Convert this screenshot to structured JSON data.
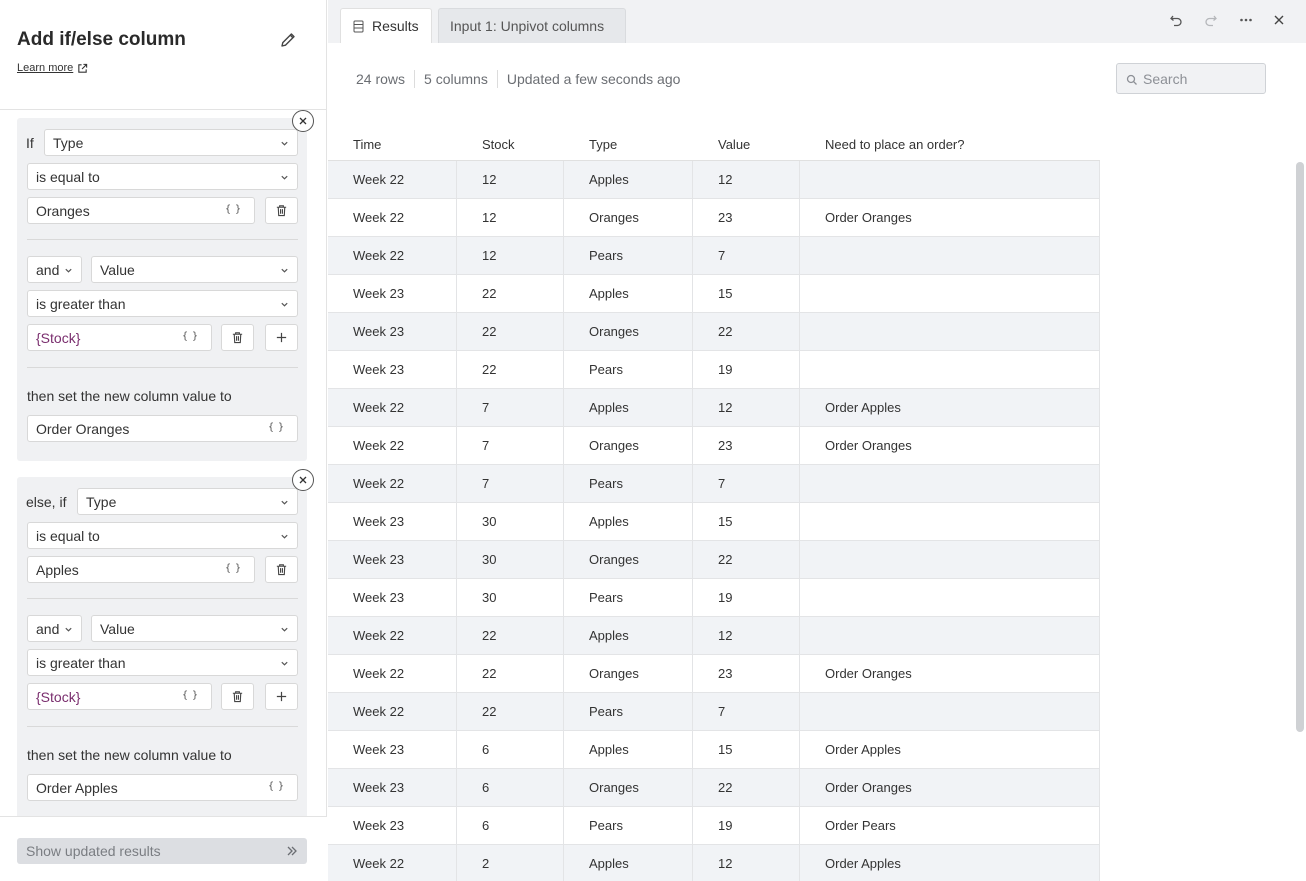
{
  "panel": {
    "title": "Add if/else column",
    "learn_more": "Learn more"
  },
  "condition_blocks": [
    {
      "lead_label": "If",
      "column": "Type",
      "operator": "is equal to",
      "value": "Oranges",
      "and_label": "and",
      "and_column": "Value",
      "and_operator": "is greater than",
      "and_value": "{Stock}",
      "then_label": "then set the new column value to",
      "then_value": "Order Oranges"
    },
    {
      "lead_label": "else, if",
      "column": "Type",
      "operator": "is equal to",
      "value": "Apples",
      "and_label": "and",
      "and_column": "Value",
      "and_operator": "is greater than",
      "and_value": "{Stock}",
      "then_label": "then set the new column value to",
      "then_value": "Order Apples"
    }
  ],
  "footer": {
    "show_results": "Show updated results"
  },
  "tabs": [
    {
      "label": "Results",
      "active": true
    },
    {
      "label": "Input 1: Unpivot columns",
      "active": false
    }
  ],
  "toolbar_icons": [
    "undo-icon",
    "redo-icon",
    "more-icon",
    "close-icon"
  ],
  "meta": {
    "rows": "24 rows",
    "columns": "5 columns",
    "updated": "Updated a few seconds ago"
  },
  "search": {
    "placeholder": "Search"
  },
  "table": {
    "headers": [
      "Time",
      "Stock",
      "Type",
      "Value",
      "Need to place an order?"
    ],
    "rows": [
      [
        "Week 22",
        "12",
        "Apples",
        "12",
        ""
      ],
      [
        "Week 22",
        "12",
        "Oranges",
        "23",
        "Order Oranges"
      ],
      [
        "Week 22",
        "12",
        "Pears",
        "7",
        ""
      ],
      [
        "Week 23",
        "22",
        "Apples",
        "15",
        ""
      ],
      [
        "Week 23",
        "22",
        "Oranges",
        "22",
        ""
      ],
      [
        "Week 23",
        "22",
        "Pears",
        "19",
        ""
      ],
      [
        "Week 22",
        "7",
        "Apples",
        "12",
        "Order Apples"
      ],
      [
        "Week 22",
        "7",
        "Oranges",
        "23",
        "Order Oranges"
      ],
      [
        "Week 22",
        "7",
        "Pears",
        "7",
        ""
      ],
      [
        "Week 23",
        "30",
        "Apples",
        "15",
        ""
      ],
      [
        "Week 23",
        "30",
        "Oranges",
        "22",
        ""
      ],
      [
        "Week 23",
        "30",
        "Pears",
        "19",
        ""
      ],
      [
        "Week 22",
        "22",
        "Apples",
        "12",
        ""
      ],
      [
        "Week 22",
        "22",
        "Oranges",
        "23",
        "Order Oranges"
      ],
      [
        "Week 22",
        "22",
        "Pears",
        "7",
        ""
      ],
      [
        "Week 23",
        "6",
        "Apples",
        "15",
        "Order Apples"
      ],
      [
        "Week 23",
        "6",
        "Oranges",
        "22",
        "Order Oranges"
      ],
      [
        "Week 23",
        "6",
        "Pears",
        "19",
        "Order Pears"
      ],
      [
        "Week 22",
        "2",
        "Apples",
        "12",
        "Order Apples"
      ]
    ]
  },
  "colors": {
    "accent_variable": "#7a2e6e",
    "row_stripe": "#f1f3f6",
    "topbar": "#f1f2f4"
  }
}
